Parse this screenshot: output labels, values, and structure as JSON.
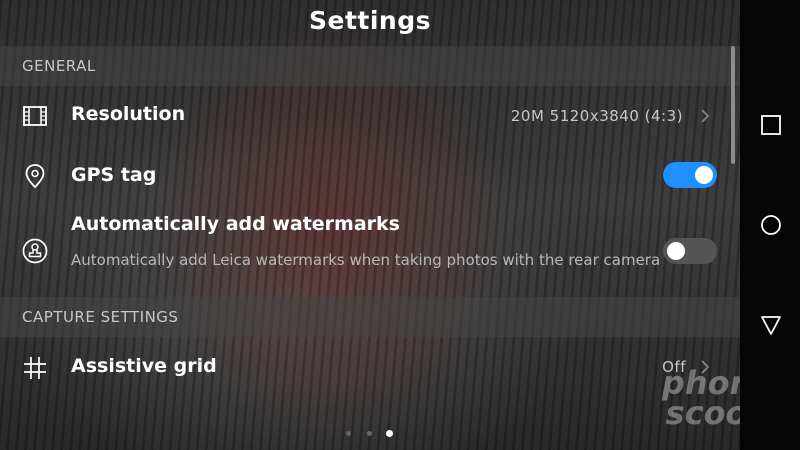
{
  "header": {
    "title": "Settings"
  },
  "sections": {
    "general": "GENERAL",
    "capture": "CAPTURE SETTINGS"
  },
  "rows": {
    "resolution": {
      "label": "Resolution",
      "value": "20M 5120x3840 (4:3)",
      "icon": "film-frame-icon"
    },
    "gps": {
      "label": "GPS tag",
      "icon": "location-pin-icon",
      "enabled": true
    },
    "watermark": {
      "label": "Automatically add watermarks",
      "description": "Automatically add Leica watermarks when taking photos with the rear camera",
      "icon": "stamp-icon",
      "enabled": false
    },
    "grid": {
      "label": "Assistive grid",
      "value": "Off",
      "icon": "grid-hash-icon"
    }
  },
  "pager": {
    "count": 3,
    "active": 3
  },
  "watermark_overlay": {
    "line1": "phone",
    "line2": "scoop"
  },
  "colors": {
    "accent": "#1e90ff",
    "toggle_off": "#555555",
    "background": "#141414"
  }
}
